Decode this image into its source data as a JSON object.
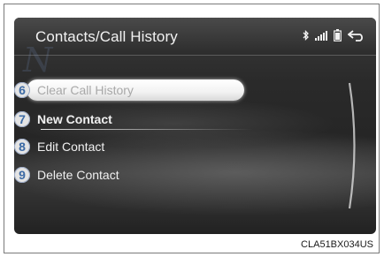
{
  "screen": {
    "title": "Contacts/Call History",
    "status_icons": [
      "bluetooth-icon",
      "signal-strength-icon",
      "battery-icon",
      "back-arrow-icon"
    ]
  },
  "menu": {
    "items": [
      {
        "number": "6",
        "label": "Clear Call History",
        "state": "selected"
      },
      {
        "number": "7",
        "label": "New Contact",
        "state": "bold"
      },
      {
        "number": "8",
        "label": "Edit Contact",
        "state": "normal"
      },
      {
        "number": "9",
        "label": "Delete Contact",
        "state": "normal"
      }
    ]
  },
  "figure_code": "CLA51BX034US",
  "colors": {
    "screen_bg": "#2a2a2a",
    "text": "#f0f0f0",
    "callout_number": "#3c6aa5",
    "callout_circle": "#e4e4e4"
  }
}
